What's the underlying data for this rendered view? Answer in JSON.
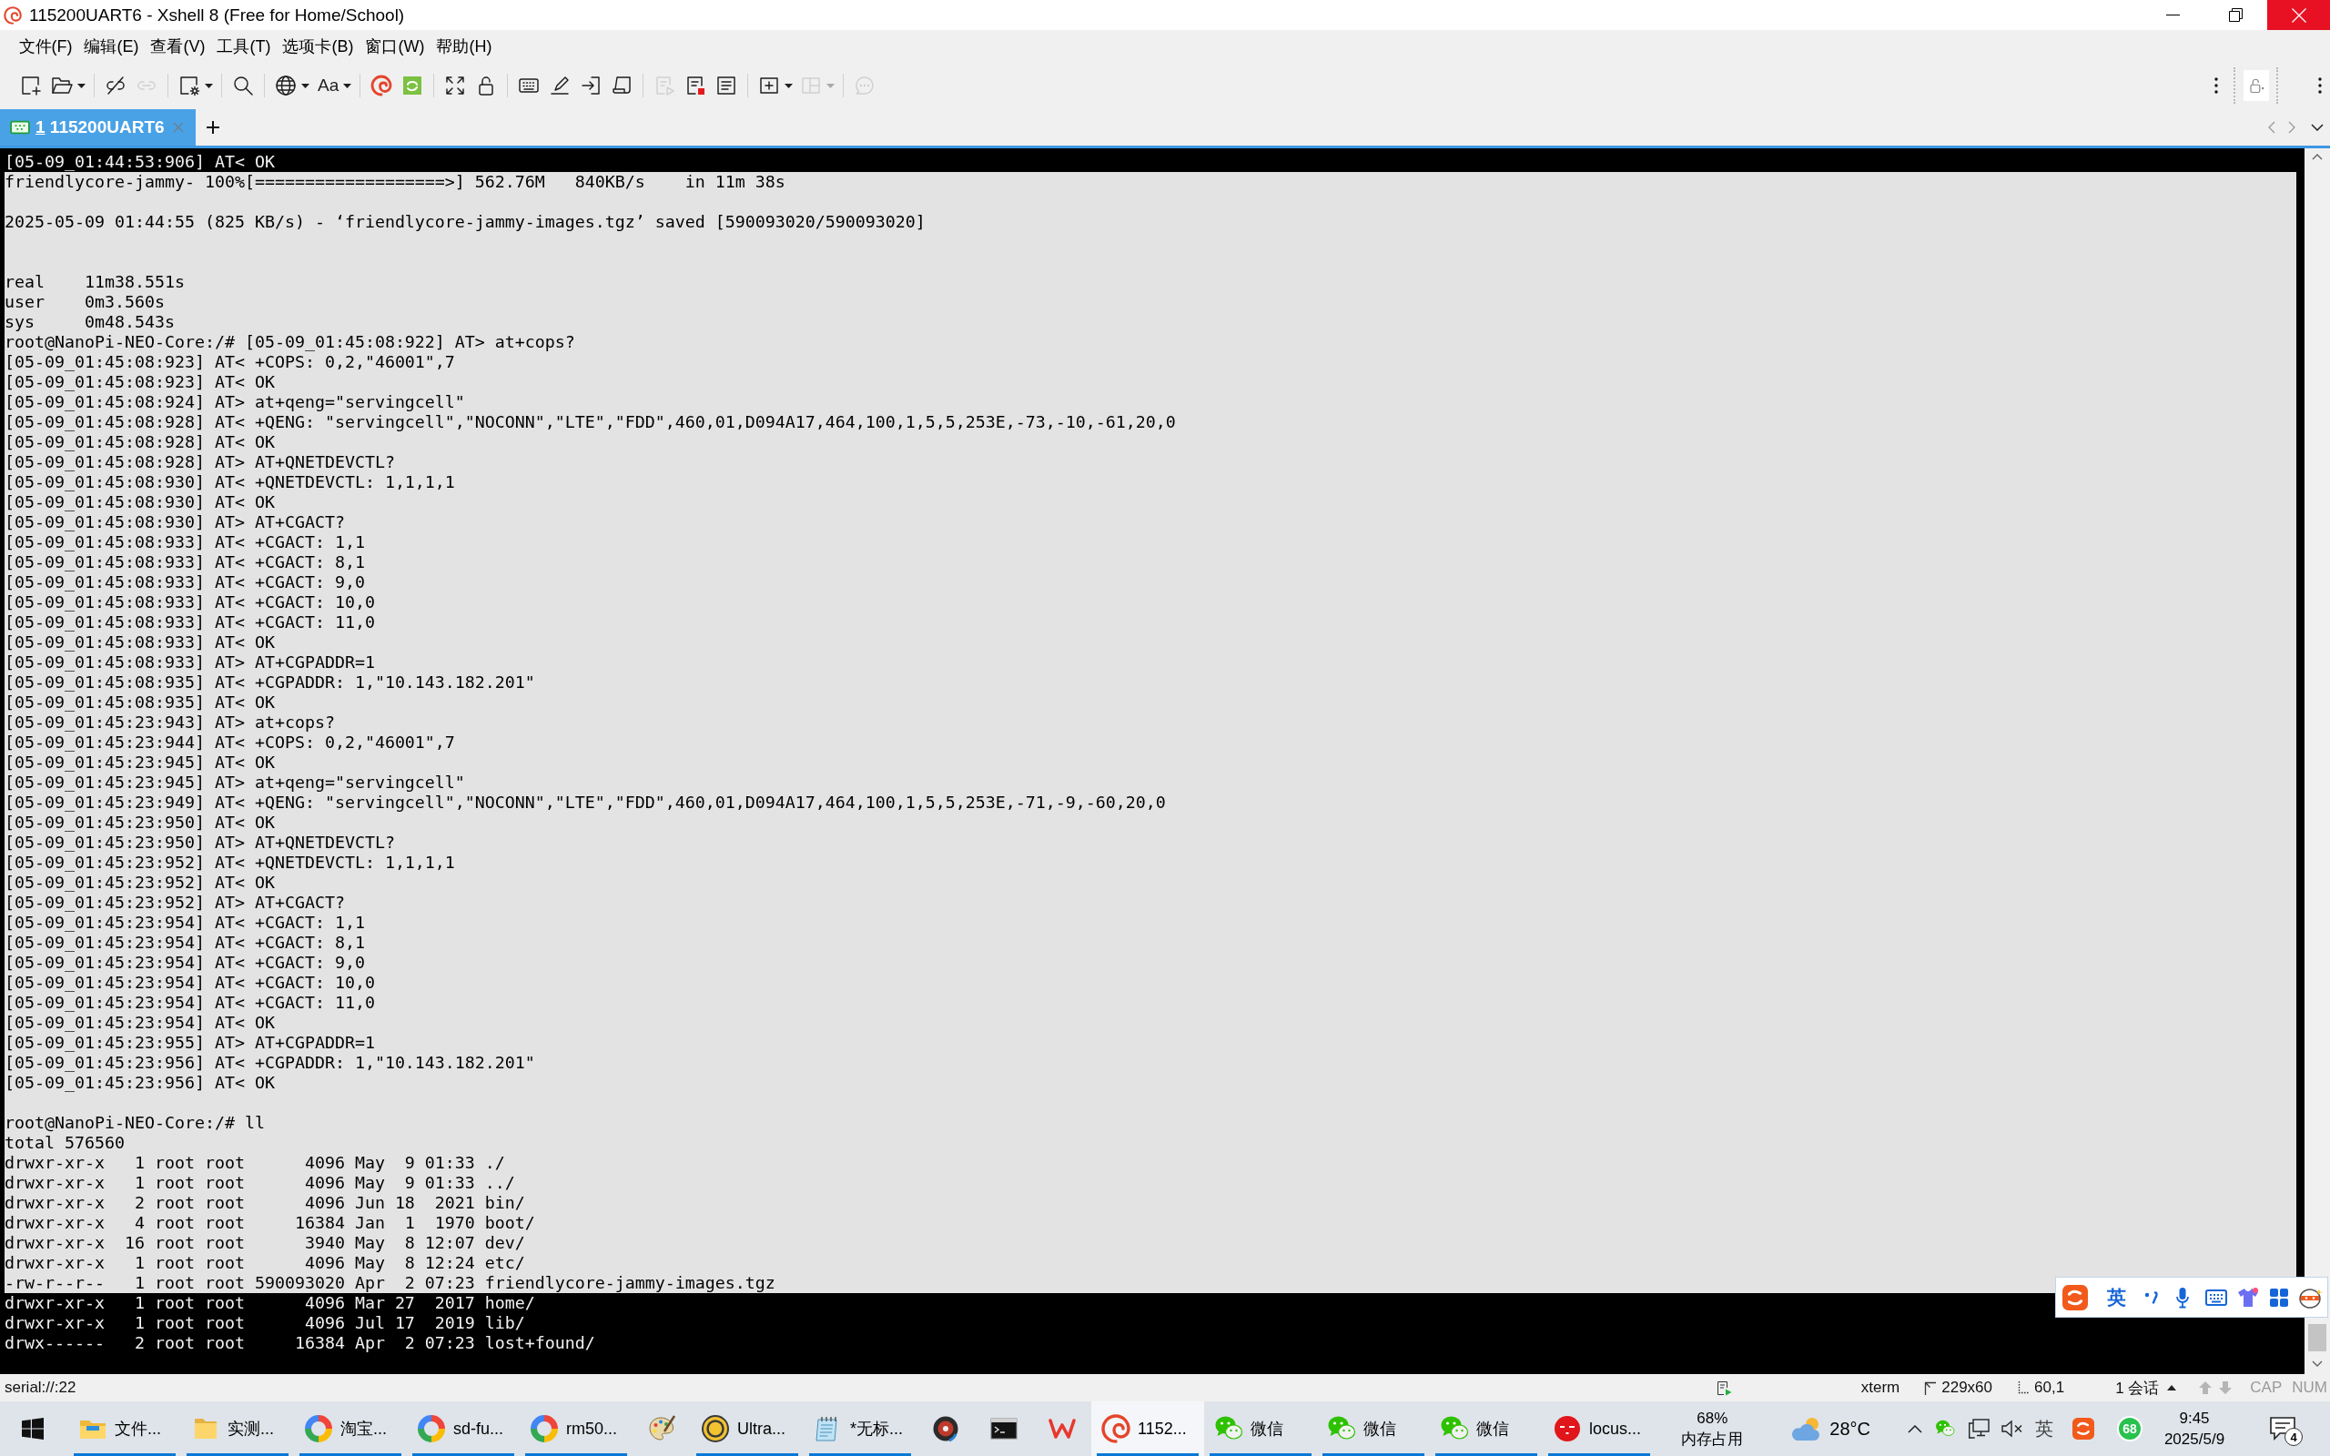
{
  "window": {
    "title": "115200UART6 - Xshell 8 (Free for Home/School)"
  },
  "menu": [
    "文件(F)",
    "编辑(E)",
    "查看(V)",
    "工具(T)",
    "选项卡(B)",
    "窗口(W)",
    "帮助(H)"
  ],
  "toolbar": {
    "groups": [
      [
        {
          "kind": "new-session",
          "dropdown": false,
          "disabled": false
        },
        {
          "kind": "open",
          "dropdown": true,
          "disabled": false
        }
      ],
      [
        {
          "kind": "disconnect",
          "dropdown": false,
          "disabled": false
        },
        {
          "kind": "reconnect",
          "dropdown": false,
          "disabled": true
        }
      ],
      [
        {
          "kind": "properties",
          "dropdown": true,
          "disabled": false
        }
      ],
      [
        {
          "kind": "find",
          "dropdown": false,
          "disabled": false
        }
      ],
      [
        {
          "kind": "encoding",
          "dropdown": true,
          "disabled": false
        },
        {
          "kind": "font",
          "label": "Aa",
          "dropdown": true,
          "disabled": false
        }
      ],
      [
        {
          "kind": "xftp",
          "dropdown": false,
          "disabled": false
        },
        {
          "kind": "xmanager",
          "dropdown": false,
          "disabled": false
        }
      ],
      [
        {
          "kind": "fullscreen",
          "dropdown": false,
          "disabled": false
        },
        {
          "kind": "lock",
          "dropdown": false,
          "disabled": false
        }
      ],
      [
        {
          "kind": "keyboard",
          "dropdown": false,
          "disabled": false
        },
        {
          "kind": "compose",
          "dropdown": false,
          "disabled": false
        },
        {
          "kind": "send",
          "dropdown": false,
          "disabled": false
        },
        {
          "kind": "script",
          "dropdown": false,
          "disabled": false
        }
      ],
      [
        {
          "kind": "play-log",
          "dropdown": false,
          "disabled": true
        },
        {
          "kind": "stop-log",
          "dropdown": false,
          "disabled": false
        },
        {
          "kind": "log",
          "dropdown": false,
          "disabled": false
        }
      ],
      [
        {
          "kind": "new-tab-group",
          "dropdown": true,
          "disabled": false
        },
        {
          "kind": "layout",
          "dropdown": true,
          "disabled": true
        }
      ],
      [
        {
          "kind": "chat",
          "dropdown": false,
          "disabled": true
        }
      ]
    ]
  },
  "tabs": [
    {
      "number": "1",
      "label": "115200UART6",
      "selected": true
    }
  ],
  "terminal": {
    "lines": [
      {
        "text": "[05-09_01:44:53:906] AT< OK",
        "selected": false
      },
      {
        "text": "friendlycore-jammy- 100%[===================>] 562.76M   840KB/s    in 11m 38s",
        "selected": true
      },
      {
        "selected": true
      },
      {
        "text": "2025-05-09 01:44:55 (825 KB/s) - ‘friendlycore-jammy-images.tgz’ saved [590093020/590093020]",
        "selected": true
      },
      {
        "selected": true
      },
      {
        "selected": true
      },
      {
        "text": "real    11m38.551s",
        "selected": true
      },
      {
        "text": "user    0m3.560s",
        "selected": true
      },
      {
        "text": "sys     0m48.543s",
        "selected": true
      },
      {
        "text": "root@NanoPi-NEO-Core:/# [05-09_01:45:08:922] AT> at+cops?",
        "selected": true
      },
      {
        "text": "[05-09_01:45:08:923] AT< +COPS: 0,2,\"46001\",7",
        "selected": true
      },
      {
        "text": "[05-09_01:45:08:923] AT< OK",
        "selected": true
      },
      {
        "text": "[05-09_01:45:08:924] AT> at+qeng=\"servingcell\"",
        "selected": true
      },
      {
        "text": "[05-09_01:45:08:928] AT< +QENG: \"servingcell\",\"NOCONN\",\"LTE\",\"FDD\",460,01,D094A17,464,100,1,5,5,253E,-73,-10,-61,20,0",
        "selected": true
      },
      {
        "text": "[05-09_01:45:08:928] AT< OK",
        "selected": true
      },
      {
        "text": "[05-09_01:45:08:928] AT> AT+QNETDEVCTL?",
        "selected": true
      },
      {
        "text": "[05-09_01:45:08:930] AT< +QNETDEVCTL: 1,1,1,1",
        "selected": true
      },
      {
        "text": "[05-09_01:45:08:930] AT< OK",
        "selected": true
      },
      {
        "text": "[05-09_01:45:08:930] AT> AT+CGACT?",
        "selected": true
      },
      {
        "text": "[05-09_01:45:08:933] AT< +CGACT: 1,1",
        "selected": true
      },
      {
        "text": "[05-09_01:45:08:933] AT< +CGACT: 8,1",
        "selected": true
      },
      {
        "text": "[05-09_01:45:08:933] AT< +CGACT: 9,0",
        "selected": true
      },
      {
        "text": "[05-09_01:45:08:933] AT< +CGACT: 10,0",
        "selected": true
      },
      {
        "text": "[05-09_01:45:08:933] AT< +CGACT: 11,0",
        "selected": true
      },
      {
        "text": "[05-09_01:45:08:933] AT< OK",
        "selected": true
      },
      {
        "text": "[05-09_01:45:08:933] AT> AT+CGPADDR=1",
        "selected": true
      },
      {
        "text": "[05-09_01:45:08:935] AT< +CGPADDR: 1,\"10.143.182.201\"",
        "selected": true
      },
      {
        "text": "[05-09_01:45:08:935] AT< OK",
        "selected": true
      },
      {
        "text": "[05-09_01:45:23:943] AT> at+cops?",
        "selected": true
      },
      {
        "text": "[05-09_01:45:23:944] AT< +COPS: 0,2,\"46001\",7",
        "selected": true
      },
      {
        "text": "[05-09_01:45:23:945] AT< OK",
        "selected": true
      },
      {
        "text": "[05-09_01:45:23:945] AT> at+qeng=\"servingcell\"",
        "selected": true
      },
      {
        "text": "[05-09_01:45:23:949] AT< +QENG: \"servingcell\",\"NOCONN\",\"LTE\",\"FDD\",460,01,D094A17,464,100,1,5,5,253E,-71,-9,-60,20,0",
        "selected": true
      },
      {
        "text": "[05-09_01:45:23:950] AT< OK",
        "selected": true
      },
      {
        "text": "[05-09_01:45:23:950] AT> AT+QNETDEVCTL?",
        "selected": true
      },
      {
        "text": "[05-09_01:45:23:952] AT< +QNETDEVCTL: 1,1,1,1",
        "selected": true
      },
      {
        "text": "[05-09_01:45:23:952] AT< OK",
        "selected": true
      },
      {
        "text": "[05-09_01:45:23:952] AT> AT+CGACT?",
        "selected": true
      },
      {
        "text": "[05-09_01:45:23:954] AT< +CGACT: 1,1",
        "selected": true
      },
      {
        "text": "[05-09_01:45:23:954] AT< +CGACT: 8,1",
        "selected": true
      },
      {
        "text": "[05-09_01:45:23:954] AT< +CGACT: 9,0",
        "selected": true
      },
      {
        "text": "[05-09_01:45:23:954] AT< +CGACT: 10,0",
        "selected": true
      },
      {
        "text": "[05-09_01:45:23:954] AT< +CGACT: 11,0",
        "selected": true
      },
      {
        "text": "[05-09_01:45:23:954] AT< OK",
        "selected": true
      },
      {
        "text": "[05-09_01:45:23:955] AT> AT+CGPADDR=1",
        "selected": true
      },
      {
        "text": "[05-09_01:45:23:956] AT< +CGPADDR: 1,\"10.143.182.201\"",
        "selected": true
      },
      {
        "text": "[05-09_01:45:23:956] AT< OK",
        "selected": true
      },
      {
        "selected": true
      },
      {
        "text": "root@NanoPi-NEO-Core:/# ll",
        "selected": true
      },
      {
        "text": "total 576560",
        "selected": true
      },
      {
        "text": "drwxr-xr-x   1 root root      4096 May  9 01:33 ./",
        "selected": true
      },
      {
        "text": "drwxr-xr-x   1 root root      4096 May  9 01:33 ../",
        "selected": true
      },
      {
        "text": "drwxr-xr-x   2 root root      4096 Jun 18  2021 bin/",
        "selected": true
      },
      {
        "text": "drwxr-xr-x   4 root root     16384 Jan  1  1970 boot/",
        "selected": true
      },
      {
        "text": "drwxr-xr-x  16 root root      3940 May  8 12:07 dev/",
        "selected": true
      },
      {
        "text": "drwxr-xr-x   1 root root      4096 May  8 12:24 etc/",
        "selected": true
      },
      {
        "text": "-rw-r--r--   1 root root 590093020 Apr  2 07:23 friendlycore-jammy-images.tgz",
        "selected": true
      },
      {
        "text": "drwxr-xr-x   1 root root      4096 Mar 27  2017 home/",
        "selected": false
      },
      {
        "text": "drwxr-xr-x   1 root root      4096 Jul 17  2019 lib/",
        "selected": false
      },
      {
        "text": "drwx------   2 root root     16384 Apr  2 07:23 lost+found/",
        "selected": false
      }
    ]
  },
  "ime_bar": {
    "mode": "英"
  },
  "status_bar": {
    "connection": "serial://:22",
    "terminal_type": "xterm",
    "size": "229x60",
    "cursor": "60,1",
    "sessions": "1 会话",
    "caps": {
      "label": "CAP",
      "on": false
    },
    "num": {
      "label": "NUM",
      "on": false
    }
  },
  "taskbar": {
    "apps": [
      {
        "kind": "explorer",
        "label": "文件...",
        "running": true,
        "selected": false
      },
      {
        "kind": "folder",
        "label": "实测...",
        "running": true,
        "selected": false
      },
      {
        "kind": "browser",
        "label": "淘宝...",
        "running": true,
        "selected": false
      },
      {
        "kind": "browser",
        "label": "sd-fu...",
        "running": true,
        "selected": false
      },
      {
        "kind": "browser",
        "label": "rm50...",
        "running": true,
        "selected": false
      },
      {
        "kind": "paint",
        "running": false,
        "selected": false
      },
      {
        "kind": "editor",
        "label": "Ultra...",
        "running": true,
        "selected": false
      },
      {
        "kind": "notepad",
        "label": "*无标...",
        "running": true,
        "selected": false
      },
      {
        "kind": "player",
        "running": false,
        "selected": false
      },
      {
        "kind": "console",
        "running": false,
        "selected": false
      },
      {
        "kind": "office",
        "running": false,
        "selected": false
      },
      {
        "kind": "terminal",
        "label": "1152...",
        "running": true,
        "selected": true
      },
      {
        "kind": "chat",
        "label": "微信",
        "running": true,
        "selected": false
      },
      {
        "kind": "chat",
        "label": "微信",
        "running": true,
        "selected": false
      },
      {
        "kind": "chat",
        "label": "微信",
        "running": true,
        "selected": false
      },
      {
        "kind": "media",
        "label": "locus...",
        "running": true,
        "selected": false
      }
    ],
    "memory": {
      "value": "68%",
      "label": "内存占用"
    },
    "weather": {
      "temperature": "28°C"
    },
    "tray": {
      "ime": "英",
      "score": "68"
    },
    "clock": {
      "time": "9:45",
      "date": "2025/5/9"
    },
    "notifications": {
      "count": "4"
    }
  }
}
